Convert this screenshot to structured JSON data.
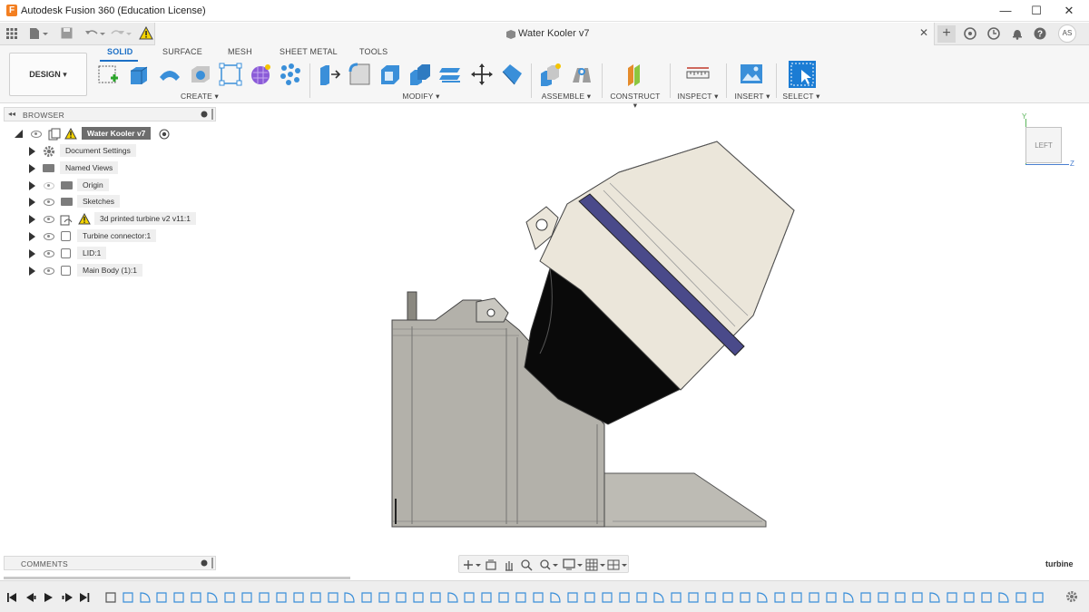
{
  "window": {
    "title": "Autodesk Fusion 360 (Education License)",
    "app_logo": "F",
    "minimize": "—",
    "maximize": "☐",
    "close": "✕"
  },
  "document": {
    "tab_title": "Water Kooler v7",
    "close": "✕",
    "user_initials": "AS"
  },
  "ribbon": {
    "workspace_button": "DESIGN ▾",
    "tabs": [
      {
        "label": "SOLID",
        "active": true
      },
      {
        "label": "SURFACE",
        "active": false
      },
      {
        "label": "MESH",
        "active": false
      },
      {
        "label": "SHEET METAL",
        "active": false
      },
      {
        "label": "TOOLS",
        "active": false
      }
    ],
    "groups": {
      "create": "CREATE ▾",
      "modify": "MODIFY ▾",
      "assemble": "ASSEMBLE ▾",
      "construct": "CONSTRUCT ▾",
      "inspect": "INSPECT ▾",
      "insert": "INSERT ▾",
      "select": "SELECT ▾"
    }
  },
  "browser": {
    "header": "BROWSER",
    "root": "Water Kooler v7",
    "items": [
      {
        "label": "Document Settings",
        "icon": "gear-icon"
      },
      {
        "label": "Named Views",
        "icon": "folder-icon"
      },
      {
        "label": "Origin",
        "icon": "folder-icon"
      },
      {
        "label": "Sketches",
        "icon": "folder-icon"
      },
      {
        "label": "3d printed turbine v2 v11:1",
        "icon": "component-icon"
      },
      {
        "label": "Turbine connector:1",
        "icon": "component-icon"
      },
      {
        "label": "LID:1",
        "icon": "component-icon"
      },
      {
        "label": "Main Body (1):1",
        "icon": "component-icon"
      }
    ]
  },
  "comments": {
    "header": "COMMENTS"
  },
  "viewcube": {
    "face": "LEFT",
    "axis_y": "Y",
    "axis_z": "Z"
  },
  "viewport": {
    "selection_label": "turbine"
  },
  "colors": {
    "accent": "#1b6fc6",
    "model_housing": "#ebe6da",
    "model_base": "#bdbbb4",
    "model_band": "#4a4a8a",
    "warning": "#f5d400"
  }
}
